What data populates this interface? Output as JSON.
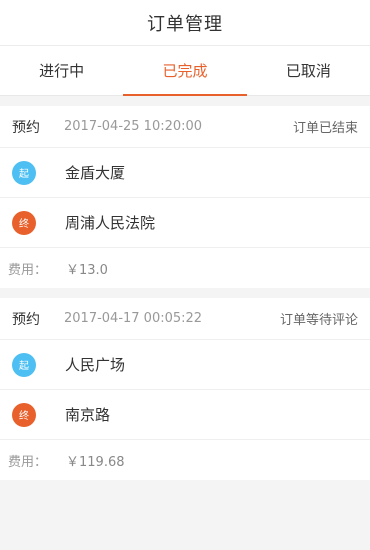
{
  "header": {
    "title": "订单管理"
  },
  "tabs": [
    {
      "label": "进行中",
      "active": false
    },
    {
      "label": "已完成",
      "active": true
    },
    {
      "label": "已取消",
      "active": false
    }
  ],
  "colors": {
    "accent": "#e8612c",
    "start_badge": "#4ebff2",
    "end_badge": "#e8612c"
  },
  "orders": [
    {
      "type": "预约",
      "time": "2017-04-25 10:20:00",
      "status": "订单已结束",
      "start": {
        "badge": "起",
        "place": "金盾大厦"
      },
      "end": {
        "badge": "终",
        "place": "周浦人民法院"
      },
      "fee_label": "费用：",
      "fee": "￥13.0"
    },
    {
      "type": "预约",
      "time": "2017-04-17 00:05:22",
      "status": "订单等待评论",
      "start": {
        "badge": "起",
        "place": "人民广场"
      },
      "end": {
        "badge": "终",
        "place": "南京路"
      },
      "fee_label": "费用：",
      "fee": "￥119.68"
    }
  ]
}
